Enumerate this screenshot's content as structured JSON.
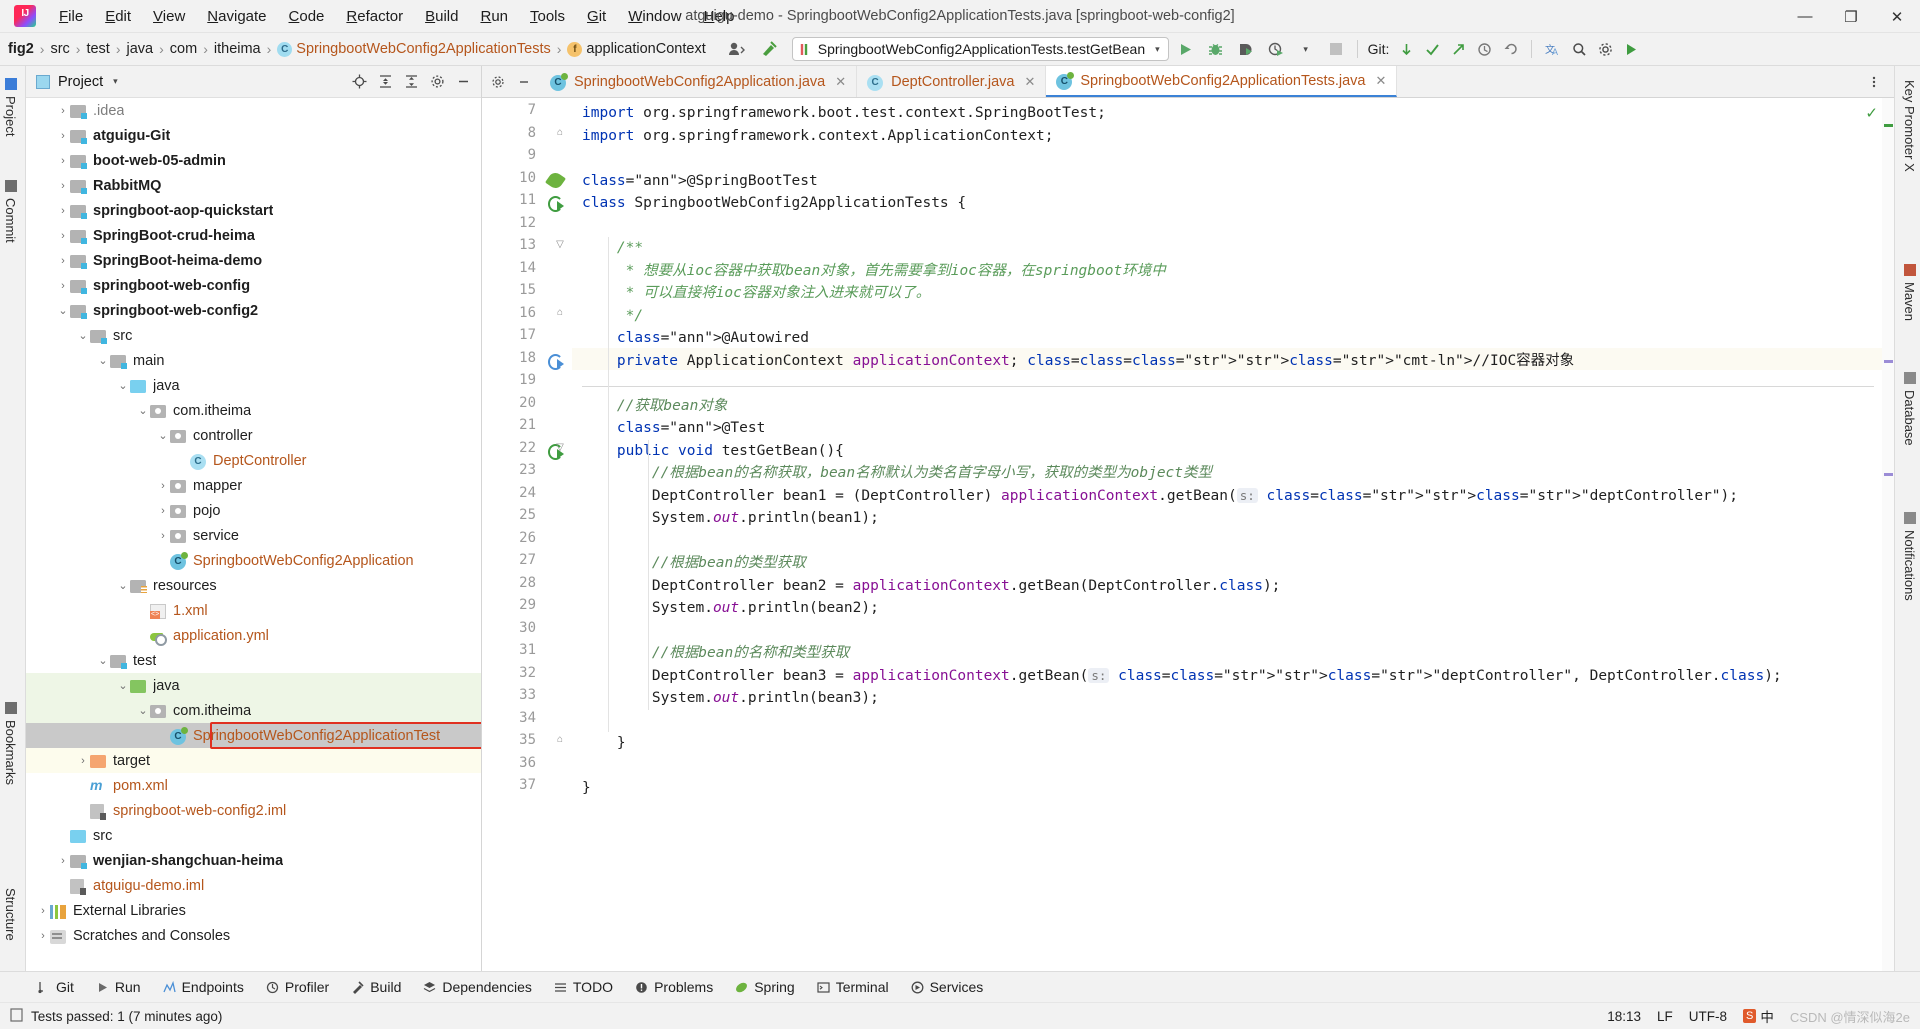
{
  "window": {
    "title": "atguigu-demo - SpringbootWebConfig2ApplicationTests.java [springboot-web-config2]",
    "minimize": "—",
    "maximize": "❐",
    "close": "✕"
  },
  "menu": [
    "File",
    "Edit",
    "View",
    "Navigate",
    "Code",
    "Refactor",
    "Build",
    "Run",
    "Tools",
    "Git",
    "Window",
    "Help"
  ],
  "breadcrumbs": [
    {
      "label": "fig2",
      "bold": true,
      "icon": ""
    },
    {
      "label": "src",
      "bold": false,
      "icon": ""
    },
    {
      "label": "test",
      "bold": false,
      "icon": ""
    },
    {
      "label": "java",
      "bold": false,
      "icon": ""
    },
    {
      "label": "com",
      "bold": false,
      "icon": ""
    },
    {
      "label": "itheima",
      "bold": false,
      "icon": ""
    },
    {
      "label": "SpringbootWebConfig2ApplicationTests",
      "bold": false,
      "icon": "class-icon",
      "color": "orange"
    },
    {
      "label": "applicationContext",
      "bold": false,
      "icon": "field-icon"
    }
  ],
  "toolbar": {
    "run_config": "SpringbootWebConfig2ApplicationTests.testGetBean",
    "run_config_dropdown": "▾",
    "run_button": "run-icon",
    "debug_button": "debug-icon",
    "run_coverage_button": "coverage-icon",
    "profiler_button": "profiler-icon",
    "profiler_dropdown": "▾",
    "stop_button": "stop-icon",
    "git_label": "Git:",
    "git_update": "update-project-icon",
    "git_commit": "commit-icon",
    "git_push": "push-icon",
    "git_history": "history-icon",
    "git_rollback": "rollback-icon",
    "translate": "translate-icon",
    "search": "search-icon",
    "settings": "settings-icon",
    "hammer": "make-icon"
  },
  "left_strips": [
    "Project",
    "Commit",
    "Bookmarks",
    "Structure"
  ],
  "right_strips": [
    "Key Promoter X",
    "Maven",
    "Database",
    "Notifications"
  ],
  "project_panel": {
    "title": "Project",
    "caret": "▾",
    "tools": [
      "locate-icon",
      "collapse-all-icon",
      "expand-all-icon",
      "settings-icon",
      "hide-icon"
    ]
  },
  "tree": [
    {
      "label": ".idea",
      "depth": 1,
      "arrow": "›",
      "icon": "folder-gray",
      "bold": false,
      "style": "",
      "color": "gray"
    },
    {
      "label": "atguigu-Git",
      "depth": 1,
      "arrow": "›",
      "icon": "folder-module",
      "bold": true,
      "style": "",
      "color": ""
    },
    {
      "label": "boot-web-05-admin",
      "depth": 1,
      "arrow": "›",
      "icon": "folder-module",
      "bold": true,
      "style": "",
      "color": ""
    },
    {
      "label": "RabbitMQ",
      "depth": 1,
      "arrow": "›",
      "icon": "folder-module",
      "bold": true,
      "style": "",
      "color": ""
    },
    {
      "label": "springboot-aop-quickstart",
      "depth": 1,
      "arrow": "›",
      "icon": "folder-module",
      "bold": true,
      "style": "",
      "color": ""
    },
    {
      "label": "SpringBoot-crud-heima",
      "depth": 1,
      "arrow": "›",
      "icon": "folder-module",
      "bold": true,
      "style": "",
      "color": ""
    },
    {
      "label": "SpringBoot-heima-demo",
      "depth": 1,
      "arrow": "›",
      "icon": "folder-module",
      "bold": true,
      "style": "",
      "color": ""
    },
    {
      "label": "springboot-web-config",
      "depth": 1,
      "arrow": "›",
      "icon": "folder-module",
      "bold": true,
      "style": "",
      "color": ""
    },
    {
      "label": "springboot-web-config2",
      "depth": 1,
      "arrow": "⌄",
      "icon": "folder-module",
      "bold": true,
      "style": "",
      "color": ""
    },
    {
      "label": "src",
      "depth": 2,
      "arrow": "⌄",
      "icon": "folder-gray",
      "bold": false,
      "style": "",
      "color": ""
    },
    {
      "label": "main",
      "depth": 3,
      "arrow": "⌄",
      "icon": "folder-gray",
      "bold": false,
      "style": "",
      "color": ""
    },
    {
      "label": "java",
      "depth": 4,
      "arrow": "⌄",
      "icon": "folder-blue",
      "bold": false,
      "style": "",
      "color": ""
    },
    {
      "label": "com.itheima",
      "depth": 5,
      "arrow": "⌄",
      "icon": "folder-pkg",
      "bold": false,
      "style": "",
      "color": ""
    },
    {
      "label": "controller",
      "depth": 6,
      "arrow": "⌄",
      "icon": "folder-pkg",
      "bold": false,
      "style": "",
      "color": ""
    },
    {
      "label": "DeptController",
      "depth": 7,
      "arrow": "",
      "icon": "class-icon",
      "bold": false,
      "style": "",
      "color": "orange"
    },
    {
      "label": "mapper",
      "depth": 6,
      "arrow": "›",
      "icon": "folder-pkg",
      "bold": false,
      "style": "",
      "color": ""
    },
    {
      "label": "pojo",
      "depth": 6,
      "arrow": "›",
      "icon": "folder-pkg",
      "bold": false,
      "style": "",
      "color": ""
    },
    {
      "label": "service",
      "depth": 6,
      "arrow": "›",
      "icon": "folder-pkg",
      "bold": false,
      "style": "",
      "color": ""
    },
    {
      "label": "SpringbootWebConfig2Application",
      "depth": 6,
      "arrow": "",
      "icon": "spring-class-icon",
      "bold": false,
      "style": "",
      "color": "orange"
    },
    {
      "label": "resources",
      "depth": 4,
      "arrow": "⌄",
      "icon": "folder-resources",
      "bold": false,
      "style": "",
      "color": ""
    },
    {
      "label": "1.xml",
      "depth": 5,
      "arrow": "",
      "icon": "xml-icon",
      "bold": false,
      "style": "",
      "color": "orange"
    },
    {
      "label": "application.yml",
      "depth": 5,
      "arrow": "",
      "icon": "yml-icon",
      "bold": false,
      "style": "",
      "color": "orange"
    },
    {
      "label": "test",
      "depth": 3,
      "arrow": "⌄",
      "icon": "folder-gray",
      "bold": false,
      "style": "",
      "color": ""
    },
    {
      "label": "java",
      "depth": 4,
      "arrow": "⌄",
      "icon": "folder-green",
      "bold": false,
      "style": "green",
      "color": ""
    },
    {
      "label": "com.itheima",
      "depth": 5,
      "arrow": "⌄",
      "icon": "folder-pkg",
      "bold": false,
      "style": "green",
      "color": ""
    },
    {
      "label": "SpringbootWebConfig2ApplicationTest",
      "depth": 6,
      "arrow": "",
      "icon": "spring-class-icon",
      "bold": false,
      "style": "selected",
      "color": "orange"
    },
    {
      "label": "target",
      "depth": 2,
      "arrow": "›",
      "icon": "folder-orange",
      "bold": false,
      "style": "yellow",
      "color": ""
    },
    {
      "label": "pom.xml",
      "depth": 2,
      "arrow": "",
      "icon": "maven-icon",
      "bold": false,
      "style": "",
      "color": "orange"
    },
    {
      "label": "springboot-web-config2.iml",
      "depth": 2,
      "arrow": "",
      "icon": "iml-icon",
      "bold": false,
      "style": "",
      "color": "orange"
    },
    {
      "label": "src",
      "depth": 1,
      "arrow": "",
      "icon": "folder-blue",
      "bold": false,
      "style": "",
      "color": ""
    },
    {
      "label": "wenjian-shangchuan-heima",
      "depth": 1,
      "arrow": "›",
      "icon": "folder-module",
      "bold": true,
      "style": "",
      "color": ""
    },
    {
      "label": "atguigu-demo.iml",
      "depth": 1,
      "arrow": "",
      "icon": "iml-icon",
      "bold": false,
      "style": "",
      "color": "orange"
    },
    {
      "label": "External Libraries",
      "depth": 0,
      "arrow": "›",
      "icon": "library-icon",
      "bold": false,
      "style": "",
      "color": ""
    },
    {
      "label": "Scratches and Consoles",
      "depth": 0,
      "arrow": "›",
      "icon": "scratch-icon",
      "bold": false,
      "style": "",
      "color": ""
    }
  ],
  "editor_tabs": [
    {
      "label": "SpringbootWebConfig2Application.java",
      "icon": "spring-class-icon",
      "active": false,
      "close": "✕"
    },
    {
      "label": "DeptController.java",
      "icon": "class-icon",
      "active": false,
      "close": "✕"
    },
    {
      "label": "SpringbootWebConfig2ApplicationTests.java",
      "icon": "spring-class-icon",
      "active": true,
      "close": "✕"
    }
  ],
  "code": {
    "first_line": 7,
    "lines": [
      {
        "n": 7,
        "gutter": "",
        "fold": "",
        "text": "import org.springframework.boot.test.context.SpringBootTest;"
      },
      {
        "n": 8,
        "gutter": "",
        "fold": "⌂",
        "text": "import org.springframework.context.ApplicationContext;"
      },
      {
        "n": 9,
        "gutter": "",
        "fold": "",
        "text": ""
      },
      {
        "n": 10,
        "gutter": "spring-leaf",
        "fold": "",
        "text": "@SpringBootTest"
      },
      {
        "n": 11,
        "gutter": "run-test",
        "fold": "",
        "text": "class SpringbootWebConfig2ApplicationTests {"
      },
      {
        "n": 12,
        "gutter": "",
        "fold": "",
        "text": ""
      },
      {
        "n": 13,
        "gutter": "",
        "fold": "▽",
        "text": "    /**"
      },
      {
        "n": 14,
        "gutter": "",
        "fold": "",
        "text": "     * 想要从ioc容器中获取bean对象，首先需要拿到ioc容器，在springboot环境中"
      },
      {
        "n": 15,
        "gutter": "",
        "fold": "",
        "text": "     * 可以直接将ioc容器对象注入进来就可以了。"
      },
      {
        "n": 16,
        "gutter": "",
        "fold": "⌂",
        "text": "     */"
      },
      {
        "n": 17,
        "gutter": "",
        "fold": "",
        "text": "    @Autowired"
      },
      {
        "n": 18,
        "gutter": "bean",
        "fold": "",
        "text": "    private ApplicationContext applicationContext; //IOC容器对象"
      },
      {
        "n": 19,
        "gutter": "",
        "fold": "",
        "text": ""
      },
      {
        "n": 20,
        "gutter": "",
        "fold": "",
        "text": "    //获取bean对象"
      },
      {
        "n": 21,
        "gutter": "",
        "fold": "",
        "text": "    @Test"
      },
      {
        "n": 22,
        "gutter": "run-test",
        "fold": "▽",
        "text": "    public void testGetBean(){"
      },
      {
        "n": 23,
        "gutter": "",
        "fold": "",
        "text": "        //根据bean的名称获取，bean名称默认为类名首字母小写，获取的类型为object类型"
      },
      {
        "n": 24,
        "gutter": "",
        "fold": "",
        "text": "        DeptController bean1 = (DeptController) applicationContext.getBean( s: \"deptController\");"
      },
      {
        "n": 25,
        "gutter": "",
        "fold": "",
        "text": "        System.out.println(bean1);"
      },
      {
        "n": 26,
        "gutter": "",
        "fold": "",
        "text": ""
      },
      {
        "n": 27,
        "gutter": "",
        "fold": "",
        "text": "        //根据bean的类型获取"
      },
      {
        "n": 28,
        "gutter": "",
        "fold": "",
        "text": "        DeptController bean2 = applicationContext.getBean(DeptController.class);"
      },
      {
        "n": 29,
        "gutter": "",
        "fold": "",
        "text": "        System.out.println(bean2);"
      },
      {
        "n": 30,
        "gutter": "",
        "fold": "",
        "text": ""
      },
      {
        "n": 31,
        "gutter": "",
        "fold": "",
        "text": "        //根据bean的名称和类型获取"
      },
      {
        "n": 32,
        "gutter": "",
        "fold": "",
        "text": "        DeptController bean3 = applicationContext.getBean( s: \"deptController\", DeptController.class);"
      },
      {
        "n": 33,
        "gutter": "",
        "fold": "",
        "text": "        System.out.println(bean3);"
      },
      {
        "n": 34,
        "gutter": "",
        "fold": "",
        "text": ""
      },
      {
        "n": 35,
        "gutter": "",
        "fold": "⌂",
        "text": "    }"
      },
      {
        "n": 36,
        "gutter": "",
        "fold": "",
        "text": ""
      },
      {
        "n": 37,
        "gutter": "",
        "fold": "",
        "text": "}"
      }
    ]
  },
  "bottom_tools": [
    {
      "label": "Git",
      "icon": "git-icon"
    },
    {
      "label": "Run",
      "icon": "run-icon"
    },
    {
      "label": "Endpoints",
      "icon": "endpoints-icon"
    },
    {
      "label": "Profiler",
      "icon": "profiler-icon"
    },
    {
      "label": "Build",
      "icon": "build-icon"
    },
    {
      "label": "Dependencies",
      "icon": "dependencies-icon"
    },
    {
      "label": "TODO",
      "icon": "todo-icon"
    },
    {
      "label": "Problems",
      "icon": "problems-icon"
    },
    {
      "label": "Spring",
      "icon": "spring-icon"
    },
    {
      "label": "Terminal",
      "icon": "terminal-icon"
    },
    {
      "label": "Services",
      "icon": "services-icon"
    }
  ],
  "status": {
    "message": "Tests passed: 1 (7 minutes ago)",
    "time": "18:13",
    "line_sep": "LF",
    "encoding": "UTF-8",
    "ime_lang": "中",
    "watermark": "CSDN @情深似海2e"
  }
}
